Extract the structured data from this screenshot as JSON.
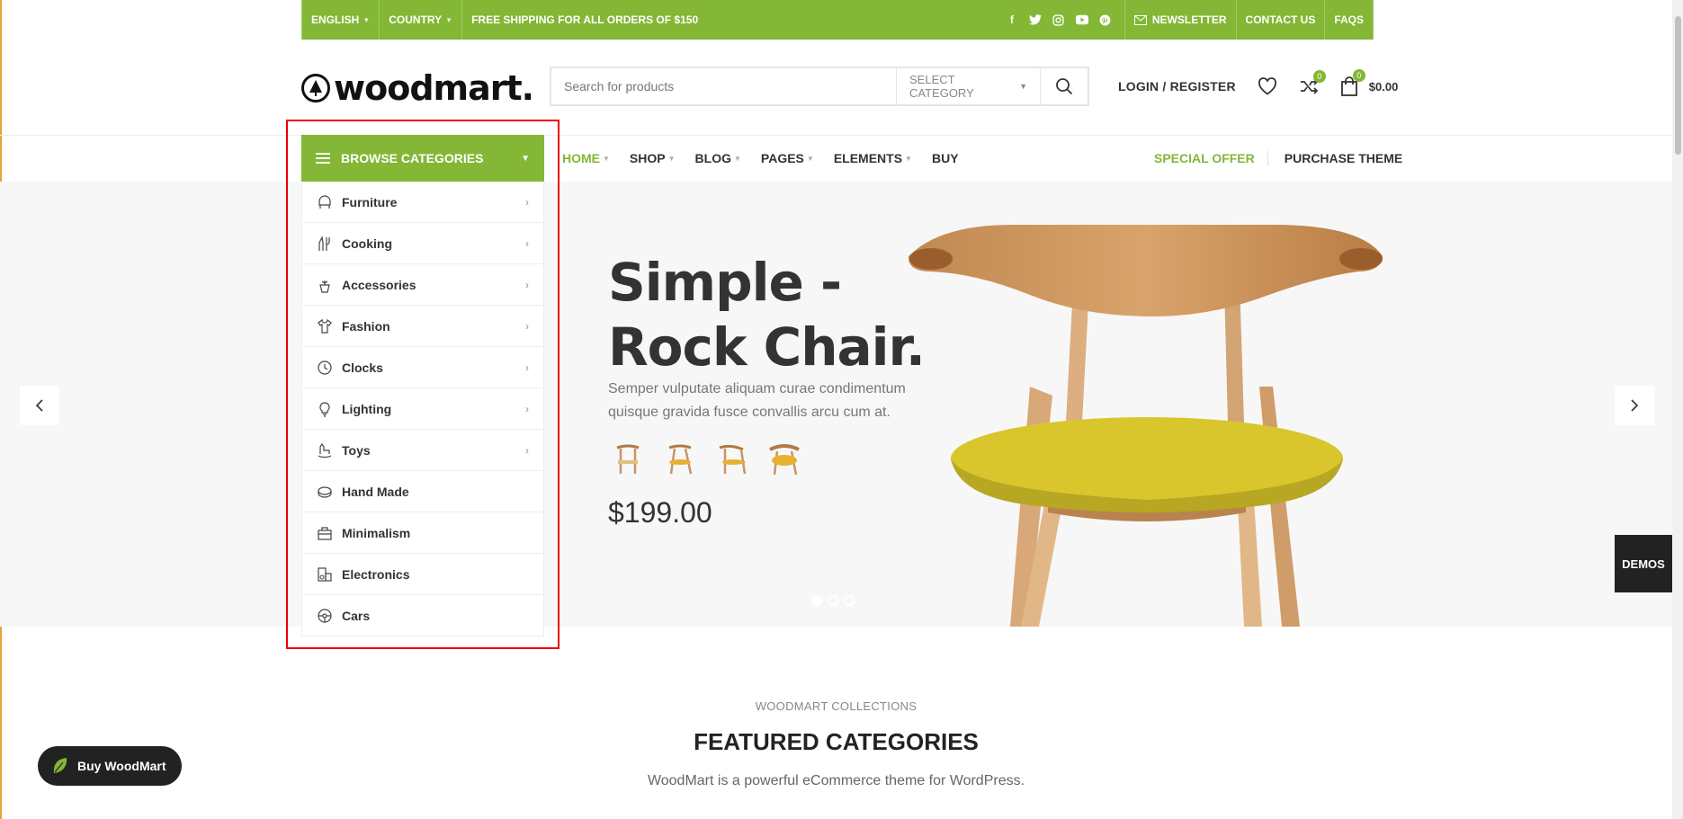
{
  "topbar": {
    "language": "ENGLISH",
    "country": "COUNTRY",
    "shipping": "FREE SHIPPING FOR ALL ORDERS OF $150",
    "newsletter": "NEWSLETTER",
    "contact": "CONTACT US",
    "faqs": "FAQS",
    "socials": [
      "facebook-icon",
      "twitter-icon",
      "instagram-icon",
      "youtube-icon",
      "pinterest-icon"
    ]
  },
  "header": {
    "logo": "woodmart.",
    "search_placeholder": "Search for products",
    "select_category": "SELECT CATEGORY",
    "login": "LOGIN / REGISTER",
    "compare_count": "0",
    "cart_count": "0",
    "cart_total": "$0.00"
  },
  "nav": {
    "browse": "BROWSE CATEGORIES",
    "items": [
      "HOME",
      "SHOP",
      "BLOG",
      "PAGES",
      "ELEMENTS",
      "BUY"
    ],
    "special_offer": "SPECIAL OFFER",
    "purchase": "PURCHASE THEME"
  },
  "categories": [
    "Furniture",
    "Cooking",
    "Accessories",
    "Fashion",
    "Clocks",
    "Lighting",
    "Toys",
    "Hand Made",
    "Minimalism",
    "Electronics",
    "Cars"
  ],
  "hero": {
    "title_line1": "Simple -",
    "title_line2": "Rock Chair.",
    "description": "Semper vulputate aliquam curae condimentum quisque gravida fusce convallis arcu cum at.",
    "price": "$199.00"
  },
  "demos": "DEMOS",
  "section": {
    "eyebrow": "WOODMART COLLECTIONS",
    "title": "FEATURED CATEGORIES",
    "description": "WoodMart is a powerful eCommerce theme for WordPress."
  },
  "buy_button": "Buy WoodMart",
  "colors": {
    "brand": "#83b735",
    "dark": "#222222",
    "highlight": "#ee0000"
  }
}
